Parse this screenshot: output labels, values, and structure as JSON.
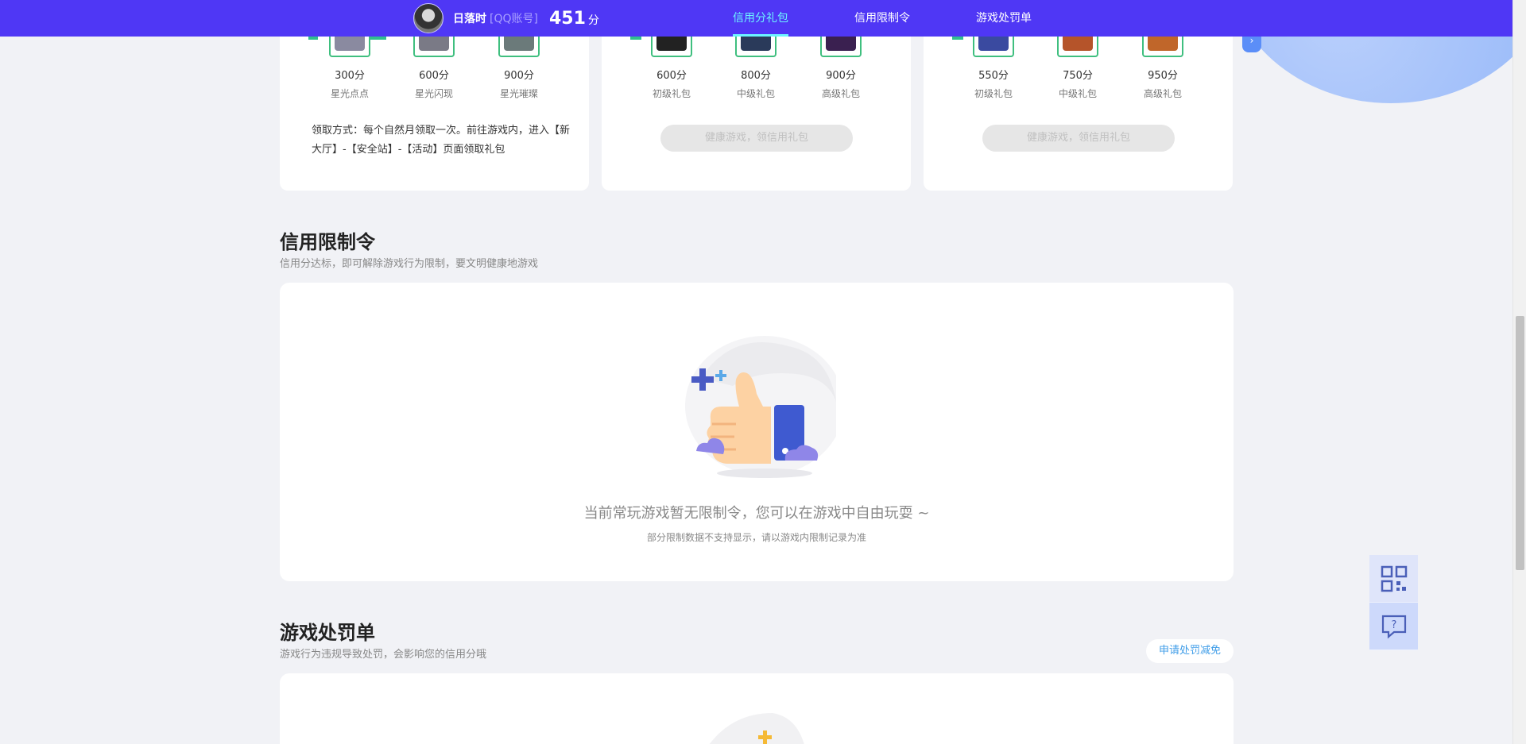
{
  "header": {
    "user_name": "日落时",
    "account_type": "[QQ账号]",
    "score": "451",
    "score_unit": "分",
    "nav": [
      {
        "label": "信用分礼包",
        "active": true
      },
      {
        "label": "信用限制令",
        "active": false
      },
      {
        "label": "游戏处罚单",
        "active": false
      }
    ]
  },
  "gift_cards": [
    {
      "gifts": [
        {
          "points": "300分",
          "name": "星光点点",
          "color": "#8a8aa0"
        },
        {
          "points": "600分",
          "name": "星光闪现",
          "color": "#7a7a86"
        },
        {
          "points": "900分",
          "name": "星光璀璨",
          "color": "#6b7a7a"
        }
      ],
      "claim_text": "领取方式：每个自然月领取一次。前往游戏内，进入【新大厅】-【安全站】-【活动】页面领取礼包"
    },
    {
      "gifts": [
        {
          "points": "600分",
          "name": "初级礼包",
          "color": "#222222"
        },
        {
          "points": "800分",
          "name": "中级礼包",
          "color": "#2a3a5a"
        },
        {
          "points": "900分",
          "name": "高级礼包",
          "color": "#3a2050"
        }
      ],
      "button": "健康游戏，领信用礼包"
    },
    {
      "gifts": [
        {
          "points": "550分",
          "name": "初级礼包",
          "color": "#3a4aa0"
        },
        {
          "points": "750分",
          "name": "中级礼包",
          "color": "#b5542a"
        },
        {
          "points": "950分",
          "name": "高级礼包",
          "color": "#c0662a"
        }
      ],
      "button": "健康游戏，领信用礼包"
    }
  ],
  "restriction": {
    "title": "信用限制令",
    "subtitle": "信用分达标，即可解除游戏行为限制，要文明健康地游戏",
    "empty_main": "当前常玩游戏暂无限制令，您可以在游戏中自由玩耍 ~",
    "empty_sub": "部分限制数据不支持显示，请以游戏内限制记录为准"
  },
  "penalty": {
    "title": "游戏处罚单",
    "subtitle": "游戏行为违规导致处罚，会影响您的信用分哦",
    "apply_button": "申请处罚减免"
  },
  "side_tools": [
    "qr-code-icon",
    "help-chat-icon"
  ],
  "colors": {
    "topbar": "#4f37f5",
    "active_nav": "#6cf4ff",
    "accent_link": "#3f9de8"
  }
}
